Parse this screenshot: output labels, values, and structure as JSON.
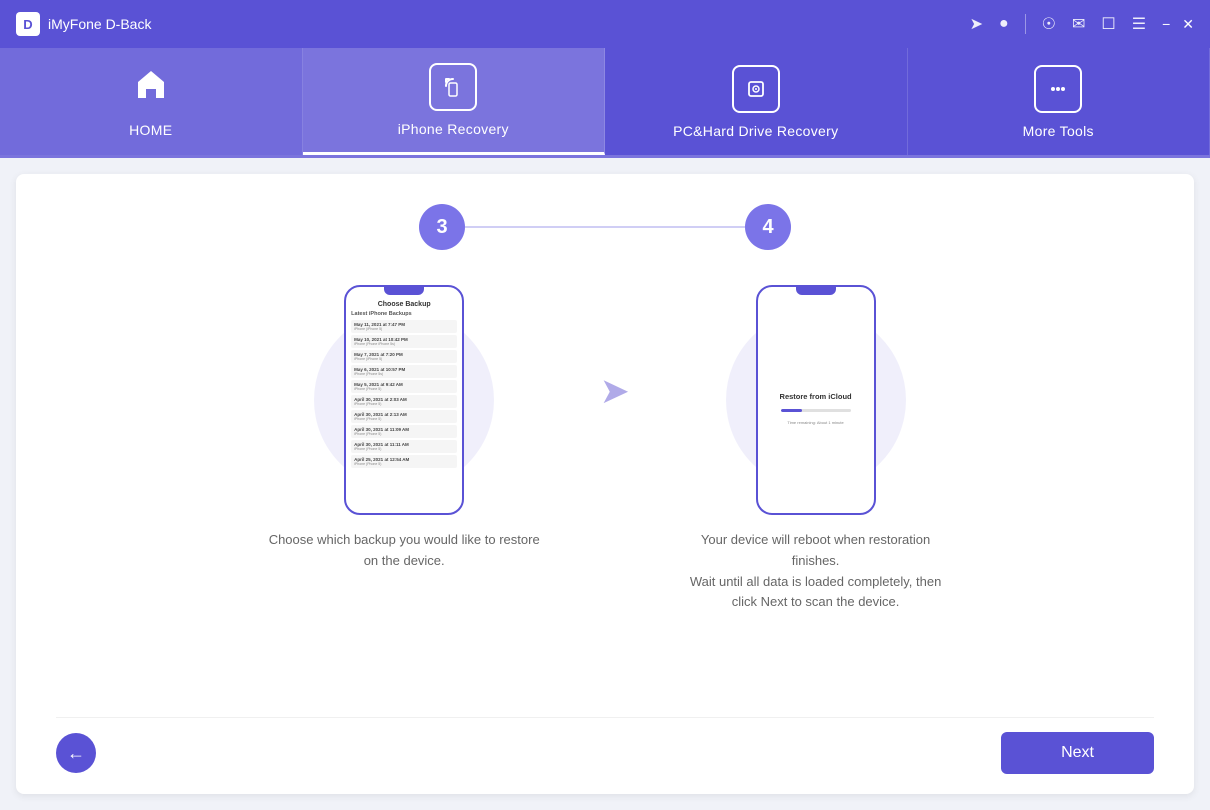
{
  "app": {
    "logo_letter": "D",
    "title": "iMyFone D-Back"
  },
  "titlebar": {
    "icons": [
      "share",
      "user",
      "location",
      "mail",
      "chat",
      "menu",
      "minimize",
      "close"
    ]
  },
  "navbar": {
    "items": [
      {
        "id": "home",
        "label": "HOME",
        "icon": "home"
      },
      {
        "id": "iphone-recovery",
        "label": "iPhone Recovery",
        "icon": "refresh"
      },
      {
        "id": "pc-hard-drive",
        "label": "PC&Hard Drive Recovery",
        "icon": "key"
      },
      {
        "id": "more-tools",
        "label": "More Tools",
        "icon": "more"
      }
    ]
  },
  "steps": {
    "current_step": 3,
    "next_step": 4
  },
  "phone1": {
    "screen_title": "Choose Backup",
    "screen_subtitle": "Latest iPhone Backups",
    "items": [
      {
        "date": "May 11, 2021 at 7:47 PM",
        "name": "iPhone (iPhone 5)"
      },
      {
        "date": "May 10, 2021 at 10:42 PM",
        "name": "iPhone (Phone iPhone 5s)"
      },
      {
        "date": "May 7, 2021 at 7:20 PM",
        "name": "iPhone (iPhone 5)"
      },
      {
        "date": "May 6, 2021 at 10:57 PM",
        "name": "iPhone (Phone 5s)"
      },
      {
        "date": "May 5, 2021 at 9:42 AM",
        "name": "iPhone (Phone 5)"
      },
      {
        "date": "April 30, 2021 at 2:03 AM",
        "name": "iPhone (Phone 5)"
      },
      {
        "date": "April 30, 2021 at 2:13 AM",
        "name": "iPhone (Phone 5)"
      },
      {
        "date": "April 30, 2021 at 11:09 AM",
        "name": "iPhone (Phone 5)"
      },
      {
        "date": "April 30, 2021 at 11:11 AM",
        "name": "iPhone (Phone 5)"
      },
      {
        "date": "April 25, 2021 at 12:54 AM",
        "name": "iPhone (Phone 5)"
      }
    ]
  },
  "phone2": {
    "screen_title": "Restore from iCloud",
    "progress_text": "Time remaining: About 1 minute"
  },
  "descriptions": {
    "step3": "Choose which backup you would like to restore\non the device.",
    "step4": "Your device will reboot when restoration\nfinishes.\nWait until all data is loaded completely, then\nclick Next to scan the device."
  },
  "buttons": {
    "back": "←",
    "next": "Next"
  }
}
